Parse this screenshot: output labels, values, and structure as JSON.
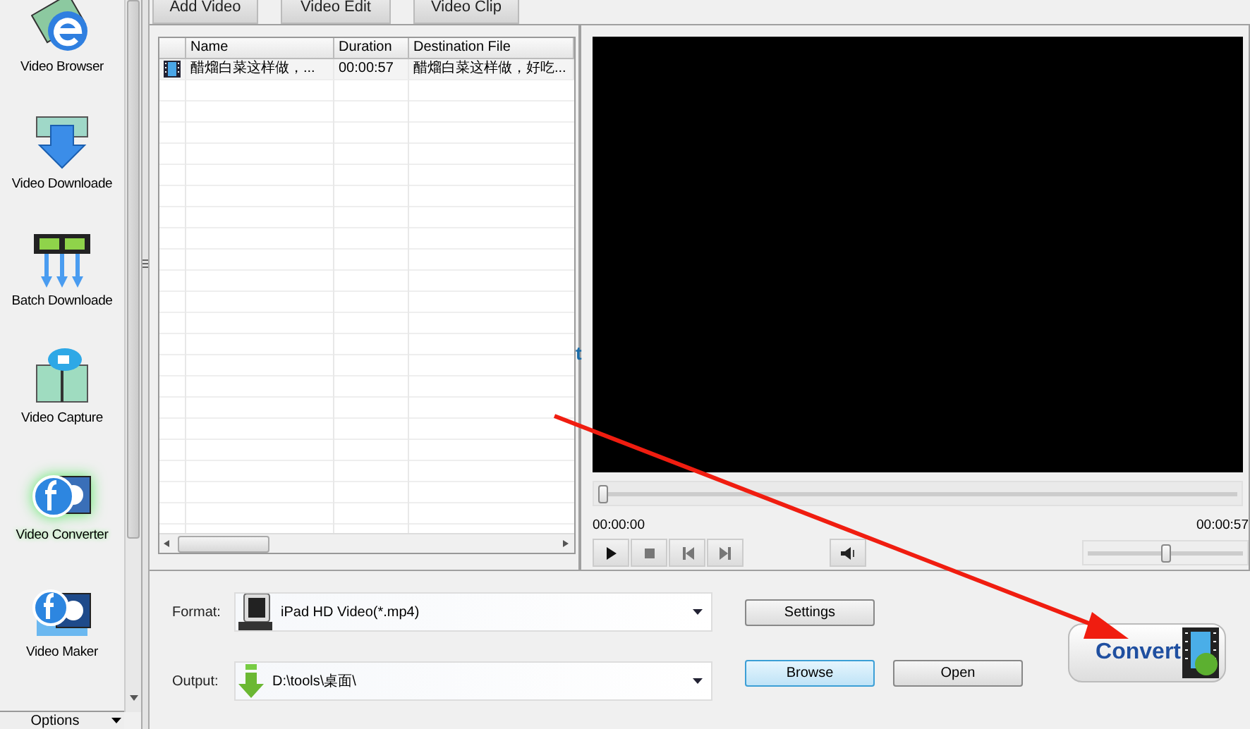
{
  "sidebar": {
    "items": [
      {
        "label": "Video Browser",
        "selected": false
      },
      {
        "label": "Video Downloade",
        "selected": false
      },
      {
        "label": "Batch Downloade",
        "selected": false
      },
      {
        "label": "Video Capture",
        "selected": false
      },
      {
        "label": "Video Converter",
        "selected": true
      },
      {
        "label": "Video Maker",
        "selected": false
      }
    ],
    "options": "Options"
  },
  "tabs": [
    {
      "label": "Add Video"
    },
    {
      "label": "Video Edit"
    },
    {
      "label": "Video Clip"
    }
  ],
  "file_list": {
    "columns": [
      "Name",
      "Duration",
      "Destination File"
    ],
    "rows": [
      {
        "name": "醋熘白菜这样做，...",
        "duration": "00:00:57",
        "destination": "醋熘白菜这样做，好吃..."
      }
    ]
  },
  "stray_text": "t",
  "player": {
    "seek": {
      "level": 0
    },
    "current_time": "00:00:00",
    "total_time": "00:00:57",
    "volume": {
      "level": 0.5
    }
  },
  "format": {
    "label": "Format:",
    "value": "iPad HD Video(*.mp4)"
  },
  "output": {
    "label": "Output:",
    "value": "D:\\tools\\桌面\\"
  },
  "buttons": {
    "settings": "Settings",
    "browse": "Browse",
    "open": "Open",
    "convert": "Convert"
  }
}
